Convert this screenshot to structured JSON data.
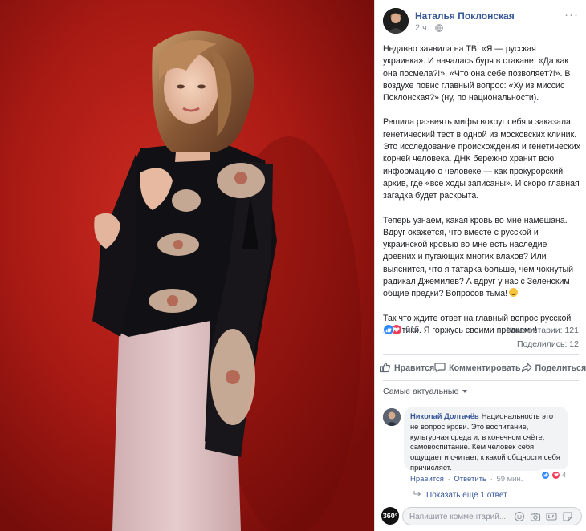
{
  "post": {
    "author": "Наталья Поклонская",
    "time": "2 ч.",
    "more": "···",
    "paragraphs": [
      "Недавно заявила на ТВ: «Я — русская украинка». И началась буря в стакане: «Да как она посмела?!», «Что она себе позволяет?!». В воздухе повис главный вопрос: «Ху из миссис Поклонская?» (ну, по национальности).",
      "Решила развеять мифы вокруг себя и заказала генетический тест в одной из московских клиник. Это исследование происхождения и генетических корней человека. ДНК бережно хранит всю информацию о человеке — как прокурорский архив, где «все ходы записаны». И скоро главная загадка будет раскрыта.",
      "Теперь узнаем, какая кровь во мне намешана. Вдруг окажется, что вместе с русской и украинской кровью во мне есть наследие древних и пугающих многих влахов? Или выяснится, что я татарка больше, чем чокнутый радикал Джемилев? А вдруг у нас с Зеленским общие предки? Вопросов тьма!",
      "Так что ждите ответ на главный вопрос русской политики. Я горжусь своими предками!"
    ],
    "reactions_count": "615",
    "comments_count": "Комментарии: 121",
    "shares_count": "Поделились: 12"
  },
  "actions": {
    "like": "Нравится",
    "comment": "Комментировать",
    "share": "Поделиться"
  },
  "comments": {
    "sort_label": "Самые актуальные",
    "items": [
      {
        "name": "Николай Долгачёв",
        "text": "Национальность это не вопрос крови. Это воспитание, культурная среда и, в конечном счёте, самовоспитание. Кем человек себя ощущает и считает, к какой общности себя причисляет.",
        "like_label": "Нравится",
        "reply_label": "Ответить",
        "time": "59 мин.",
        "reactions": "4"
      }
    ],
    "show_replies": "Показать ещё 1 ответ"
  },
  "composer": {
    "avatar_text": "360°",
    "placeholder": "Напишите комментарий..."
  },
  "colors": {
    "link": "#365899",
    "background_red": "#a81a15",
    "like_blue": "#2d88ff",
    "love_red": "#f33e58"
  },
  "icons": [
    "globe-icon",
    "like-icon",
    "love-icon",
    "thumbs-up-icon",
    "comment-icon",
    "share-icon",
    "reply-arrow-icon",
    "emoji-icon",
    "camera-icon",
    "gif-icon",
    "sticker-icon"
  ]
}
